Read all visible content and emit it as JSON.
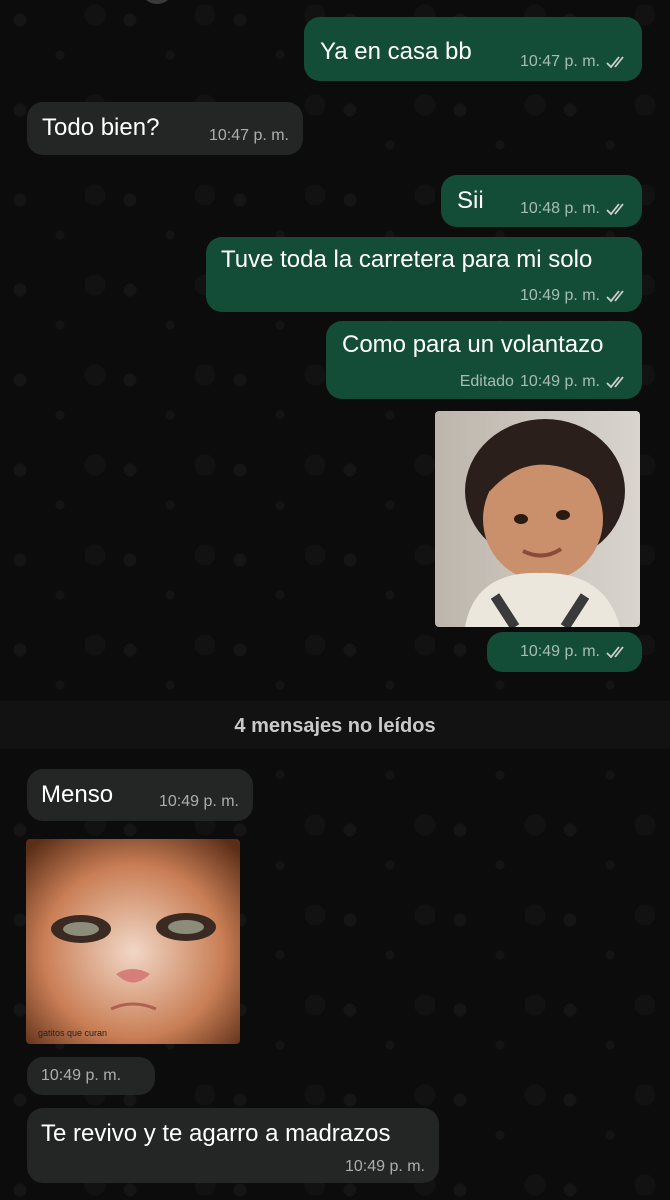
{
  "unread_divider": "4 mensajes no leídos",
  "messages": [
    {
      "text": "Ya en casa bb",
      "time": "10:47 p. m."
    },
    {
      "text": "Todo bien?",
      "time": "10:47 p. m."
    },
    {
      "text": "Sii",
      "time": "10:48 p. m."
    },
    {
      "text": "Tuve toda la carretera para mi solo",
      "time": "10:49 p. m."
    },
    {
      "text": "Como para un volantazo",
      "time": "10:49 p. m.",
      "edited_label": "Editado"
    },
    {
      "image": "child-smiling-photo",
      "time": "10:49 p. m."
    },
    {
      "text": "Menso",
      "time": "10:49 p. m."
    },
    {
      "image": "angry-cat-photo",
      "watermark": "gatitos que curan",
      "time": "10:49 p. m."
    },
    {
      "text": "Te revivo y te agarro a madrazos",
      "time": "10:49 p. m."
    }
  ],
  "colors": {
    "outgoing_bubble": "#134d37",
    "incoming_bubble": "#242626",
    "background": "#0c0c0c",
    "read_ticks": "#cfcfcf"
  }
}
